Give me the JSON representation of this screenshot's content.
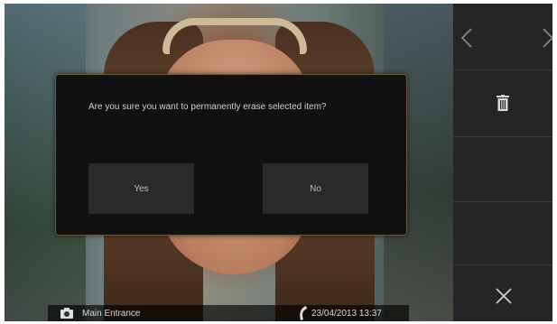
{
  "dialog": {
    "message": "Are you sure you want to permanently erase selected item?",
    "yes_label": "Yes",
    "no_label": "No"
  },
  "status_bar": {
    "location": "Main Entrance",
    "timestamp": "23/04/2013 13:37"
  },
  "side_panel": {
    "icons": [
      "chevron-left-icon",
      "chevron-right-icon",
      "trash-icon",
      "close-icon"
    ]
  },
  "colors": {
    "panel_bg": "#252525",
    "dialog_bg": "#111111",
    "dialog_border": "#6b5a3c",
    "button_bg": "#2a2a2a"
  }
}
